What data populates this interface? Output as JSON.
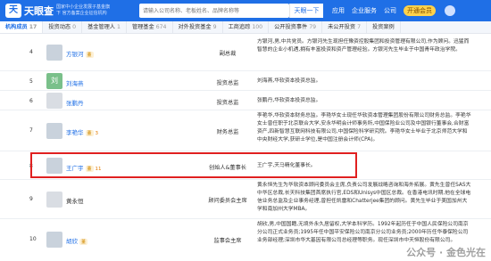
{
  "header": {
    "logo_mark": "天",
    "logo_text": "天眼查",
    "logo_sub": "国家中小企业发展子基金旗下 官方备案企业征信机构",
    "search_placeholder": "请输入公司名称、老板姓名、品牌名称等",
    "search_button": "天眼一下",
    "nav": [
      "应用",
      "企业服务",
      "公司",
      "开通会员"
    ]
  },
  "tabs": [
    {
      "label": "机构成员",
      "count": "17",
      "active": true
    },
    {
      "label": "投资动态",
      "count": "0"
    },
    {
      "label": "基金管理人",
      "count": "1"
    },
    {
      "label": "管理基金",
      "count": "674"
    },
    {
      "label": "对外投资基金",
      "count": "9"
    },
    {
      "label": "工商追踪",
      "count": "100"
    },
    {
      "label": "公开投资事件",
      "count": "79"
    },
    {
      "label": "未公开投资",
      "count": "7"
    },
    {
      "label": "投资案例",
      "count": ""
    }
  ],
  "members": [
    {
      "idx": "4",
      "name": "方银河",
      "badge": "董",
      "role": "副总裁",
      "desc": "方银河,男,中共党员。方银河先生现担任豫资控股集团和投资管理有限公司,作为顾问。迅猛而智慧的企业小机遇,拥有丰富投资和资产管理经验。方银河先生毕业于中国青年政治学院。",
      "photo": "person"
    },
    {
      "idx": "5",
      "name": "刘海燕",
      "badge": "",
      "role": "投资总监",
      "desc": "刘海燕,华软资本投资总监。",
      "photo": "green",
      "photo_char": "刘"
    },
    {
      "idx": "6",
      "name": "张鹏丹",
      "badge": "",
      "role": "投资总监",
      "desc": "张鹏丹,华软资本投资总监。",
      "photo": "text"
    },
    {
      "idx": "7",
      "name": "李艳华",
      "badge": "董",
      "count": "3",
      "role": "财务总监",
      "desc": "李艳华,华软资本财务总监。李艳华女士现任华软资本管理集团股份有限公司财务总监。李艳华女士曾任职于北京联合大学,安永华明会计师事务所,中国保险业公司及中国银行董事会,合财富资产,四新智慧互联网科技有限公司,中国保险科学研究院。李艳华女士毕业于北京师范大学和中央财经大学,获研士学位,是中国注册会计师(CPA)。",
      "photo": "person"
    },
    {
      "idx": "8",
      "name": "王广宇",
      "badge": "董",
      "count": "11",
      "role": "创始人&董事长",
      "desc": "王广宇,天马精化董事长。",
      "photo": "person"
    },
    {
      "idx": "9",
      "name": "黄永恒",
      "badge": "",
      "role": "顾问委员会主席",
      "desc": "黄永恒先生为华软资本顾问委员会主席,负责公司发展战略咨询和海外拓展。黄先生曾任SAS大中华区总裁,长天科技集团首席执行官,EDS和Unisys中国区总裁。在香港电讯时期,他在全球电信业务总监及企业事务经理,曾担任凯雷和Chatterjee集团的顾问。黄先生毕业于美国加州大学和南加州大学MBA。",
      "photo": "text"
    },
    {
      "idx": "10",
      "name": "胡欣",
      "badge": "董",
      "role": "监事会主席",
      "desc": "胡欣,男,中国国籍,无境外永久居留权,大学本科学历。1992年起历任于中国人民保险公司南京分公司正式业务员;1995年任中国平安保险公司南京分公司业务员;2000年历任华泰保险公司业务部经理;深圳市华大基因有限公司总经理等职务。现任深圳市中天恒股份有限公司。",
      "photo": "person"
    }
  ],
  "highlight_note": "red-box-around-row-8",
  "watermark": "公众号 · 金色光在"
}
